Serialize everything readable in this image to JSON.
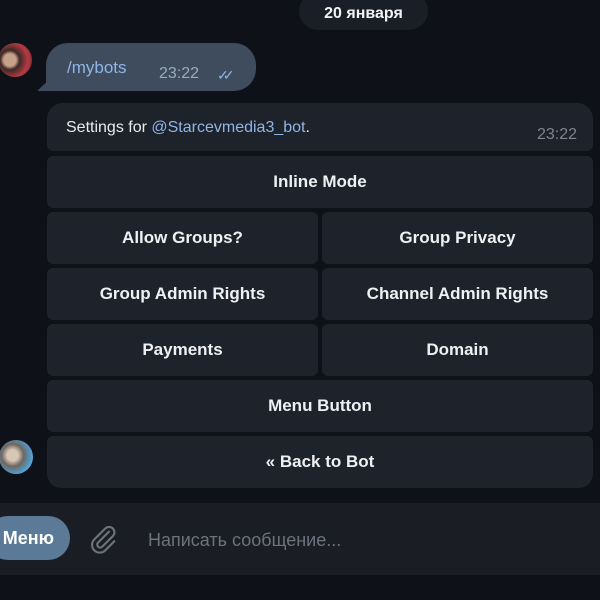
{
  "date_separator": "20 января",
  "messages": [
    {
      "direction": "outgoing",
      "text": "/mybots",
      "time": "23:22",
      "status_icon": "double-check-icon"
    },
    {
      "direction": "incoming",
      "text_prefix": "Settings for ",
      "mention": "@Starcevmedia3_bot",
      "text_suffix": ".",
      "time": "23:22"
    }
  ],
  "inline_keyboard": {
    "rows": [
      [
        "Inline Mode"
      ],
      [
        "Allow Groups?",
        "Group Privacy"
      ],
      [
        "Group Admin Rights",
        "Channel Admin Rights"
      ],
      [
        "Payments",
        "Domain"
      ],
      [
        "Menu Button"
      ],
      [
        "« Back to Bot"
      ]
    ]
  },
  "composer": {
    "menu_label": "Меню",
    "attach_icon": "paperclip-icon",
    "placeholder": "Написать сообщение..."
  },
  "colors": {
    "background": "#0e1117",
    "outgoing_bubble": "#3e4c5e",
    "incoming_bubble": "#1e222a",
    "link": "#8fb6e6",
    "menu_button": "#5b7a97"
  }
}
